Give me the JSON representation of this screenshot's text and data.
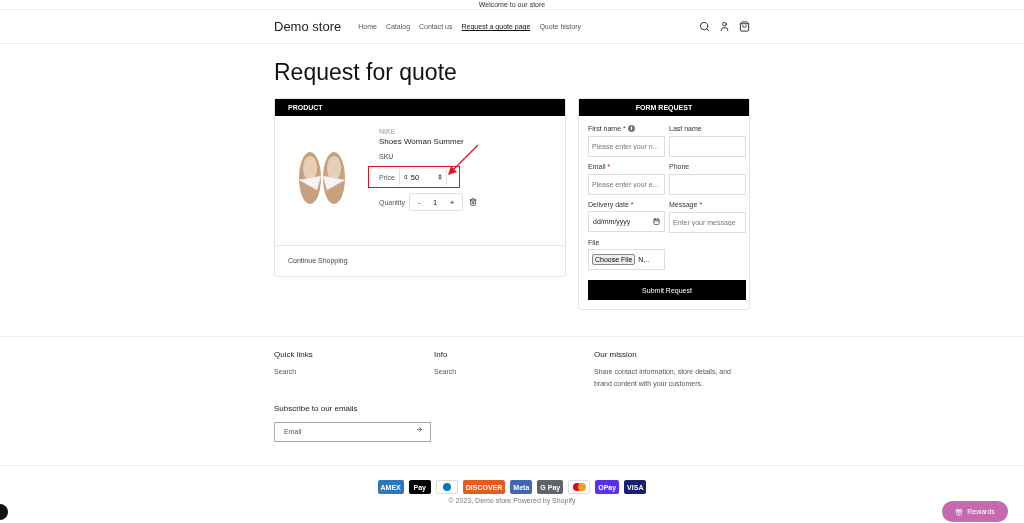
{
  "announcement": "Welcome to our store",
  "header": {
    "logo": "Demo store",
    "nav": [
      {
        "label": "Home",
        "selected": false
      },
      {
        "label": "Catalog",
        "selected": false
      },
      {
        "label": "Contact us",
        "selected": false
      },
      {
        "label": "Request a quote page",
        "selected": true
      },
      {
        "label": "Quote history",
        "selected": false
      }
    ]
  },
  "page_title": "Request for quote",
  "product_card": {
    "heading": "PRODUCT",
    "vendor": "NIKE",
    "name": "Shoes Woman Summer",
    "sku": "SKU",
    "price_label": "Price",
    "currency": "₫",
    "price": "50",
    "quantity_label": "Quantity",
    "minus": "-",
    "quantity": "1",
    "plus": "+",
    "continue": "Continue Shopping"
  },
  "form_card": {
    "heading": "FORM REQUEST",
    "fields": [
      {
        "label": "First name",
        "mark": "*",
        "info": true,
        "kind": "text",
        "placeholder": "Please enter your n..."
      },
      {
        "label": "Last name",
        "info": false,
        "kind": "text"
      },
      {
        "label": "Email",
        "mark": "*",
        "info": false,
        "kind": "text",
        "placeholder": "Please enter your e..."
      },
      {
        "label": "Phone",
        "info": false,
        "kind": "text"
      },
      {
        "label": "Delivery date",
        "mark": "*",
        "info": false,
        "kind": "date",
        "placeholder": "dd/mm/yyyy"
      },
      {
        "label": "Message",
        "mark": "*",
        "info": false,
        "kind": "text",
        "placeholder": "Enter your message"
      },
      {
        "label": "File",
        "info": false,
        "kind": "file",
        "button": "Choose File",
        "value": "N..."
      }
    ],
    "submit": "Submit Request"
  },
  "footer": {
    "columns": [
      {
        "heading": "Quick links",
        "links": [
          "Search"
        ]
      },
      {
        "heading": "Info",
        "links": [
          "Search"
        ]
      },
      {
        "heading": "Our mission",
        "text": "Share contact information, store details, and brand content with your customers."
      }
    ],
    "subscribe_heading": "Subscribe to our emails",
    "email_placeholder": "Email",
    "payments": [
      {
        "kind": "text",
        "label": "AMEX",
        "color": "#2e77bc"
      },
      {
        "kind": "text",
        "label": "Pay",
        "color": "#000000"
      },
      {
        "kind": "diners",
        "color": "#0079be"
      },
      {
        "kind": "text",
        "label": "DISCOVER",
        "color": "#e55c20"
      },
      {
        "kind": "text",
        "label": "Meta",
        "color": "#4267b2"
      },
      {
        "kind": "text",
        "label": "G Pay",
        "color": "#5f6368"
      },
      {
        "kind": "master",
        "color": "#eb001b"
      },
      {
        "kind": "text",
        "label": "OPay",
        "color": "#5a31f4"
      },
      {
        "kind": "text",
        "label": "VISA",
        "color": "#1a1f71"
      }
    ],
    "copyright": "© 2023, Demo store Powered by Shopify"
  },
  "rewards": "Rewards"
}
